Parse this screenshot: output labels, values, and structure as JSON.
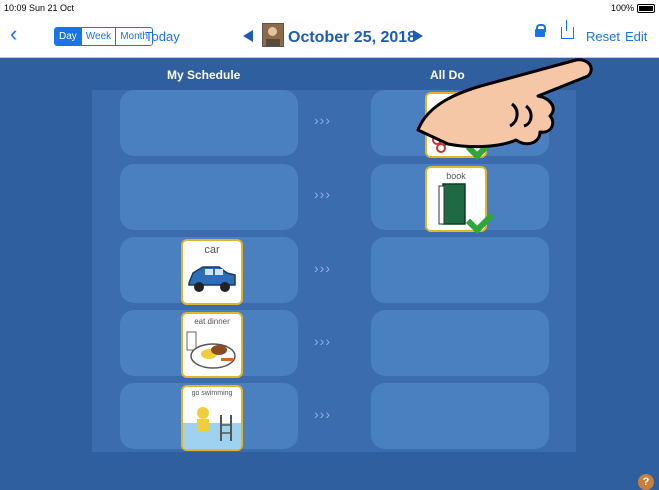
{
  "status_bar": {
    "time": "10:09  Sun 21 Oct",
    "battery": "100%"
  },
  "nav": {
    "back_label": "‹",
    "views": [
      "Day",
      "Week",
      "Month"
    ],
    "active_view": "Day",
    "today_label": "Today",
    "date": "October 25, 2018",
    "reset_label": "Reset",
    "edit_label": "Edit",
    "prev_icon": "left-triangle",
    "next_icon": "right-triangle"
  },
  "columns": {
    "left": "My Schedule",
    "right": "All Do"
  },
  "arrow_glyph": "›››",
  "rows": [
    {
      "left": null,
      "right": {
        "label": "",
        "icon": "craft-scissors",
        "done": true
      }
    },
    {
      "left": null,
      "right": {
        "label": "book",
        "icon": "book",
        "done": true
      }
    },
    {
      "left": {
        "label": "car",
        "icon": "car"
      },
      "right": null
    },
    {
      "left": {
        "label": "eat dinner",
        "icon": "dinner-plate"
      },
      "right": null
    },
    {
      "left": {
        "label": "go swimming",
        "icon": "swimming-pool"
      },
      "right": null
    }
  ],
  "help_label": "?",
  "colors": {
    "background": "#2f5f9e",
    "panel": "#3a6cae",
    "slot": "#4a7fc0",
    "accent": "#1b74e4",
    "check": "#2fa53a",
    "card_border": "#e0b62a"
  }
}
